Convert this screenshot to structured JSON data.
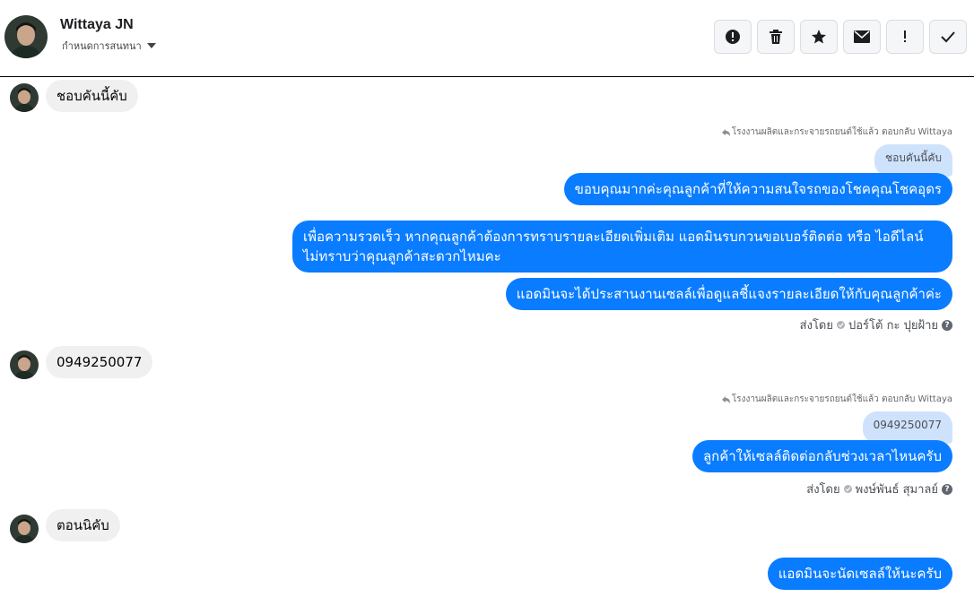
{
  "header": {
    "name": "Wittaya JN",
    "assign_label": "กำหนดการสนทนา",
    "actions": [
      {
        "icon": "alert-circle-icon",
        "label": "!"
      },
      {
        "icon": "trash-icon"
      },
      {
        "icon": "star-icon"
      },
      {
        "icon": "envelope-icon"
      },
      {
        "icon": "exclamation-icon",
        "label": "!"
      },
      {
        "icon": "check-icon"
      }
    ]
  },
  "messages": {
    "in1": "ชอบคันนี้คับ",
    "reply_note_1": "โรงงานผลิตและกระจายรถยนต์ใช้แล้ว ตอบกลับ Wittaya",
    "quote_1": "ชอบคันนี้คับ",
    "out1": "ขอบคุณมากค่ะคุณลูกค้าที่ให้ความสนใจรถของโชคคุณโชคอุดร",
    "out2": "เพื่อความรวดเร็ว หากคุณลูกค้าต้องการทราบรายละเอียดเพิ่มเติม แอดมินรบกวนขอเบอร์ติดต่อ หรือ ไอดีไลน์ ไม่ทราบว่าคุณลูกค้าสะดวกไหมคะ",
    "out3": "แอดมินจะได้ประสานงานเซลล์เพื่อดูแลชี้แจงรายละเอียดให้กับคุณลูกค้าค่ะ",
    "sent_by_label_1": "ส่งโดย",
    "sender_1": "ปอร์โต้ กะ ปุยฝ้าย",
    "in2": "0949250077",
    "reply_note_2": "โรงงานผลิตและกระจายรถยนต์ใช้แล้ว ตอบกลับ Wittaya",
    "quote_2": "0949250077",
    "out4": "ลูกค้าให้เซลล์ติดต่อกลับช่วงเวลาไหนครับ",
    "sent_by_label_2": "ส่งโดย",
    "sender_2": "พงษ์พันธ์ สุมาลย์",
    "in3": "ตอนนิคับ",
    "out5": "แอดมินจะนัดเซลล์ให้นะครับ"
  },
  "colors": {
    "outgoing": "#0a7cff",
    "incoming": "#f0f0f0",
    "quoted": "#cfe2fc"
  }
}
